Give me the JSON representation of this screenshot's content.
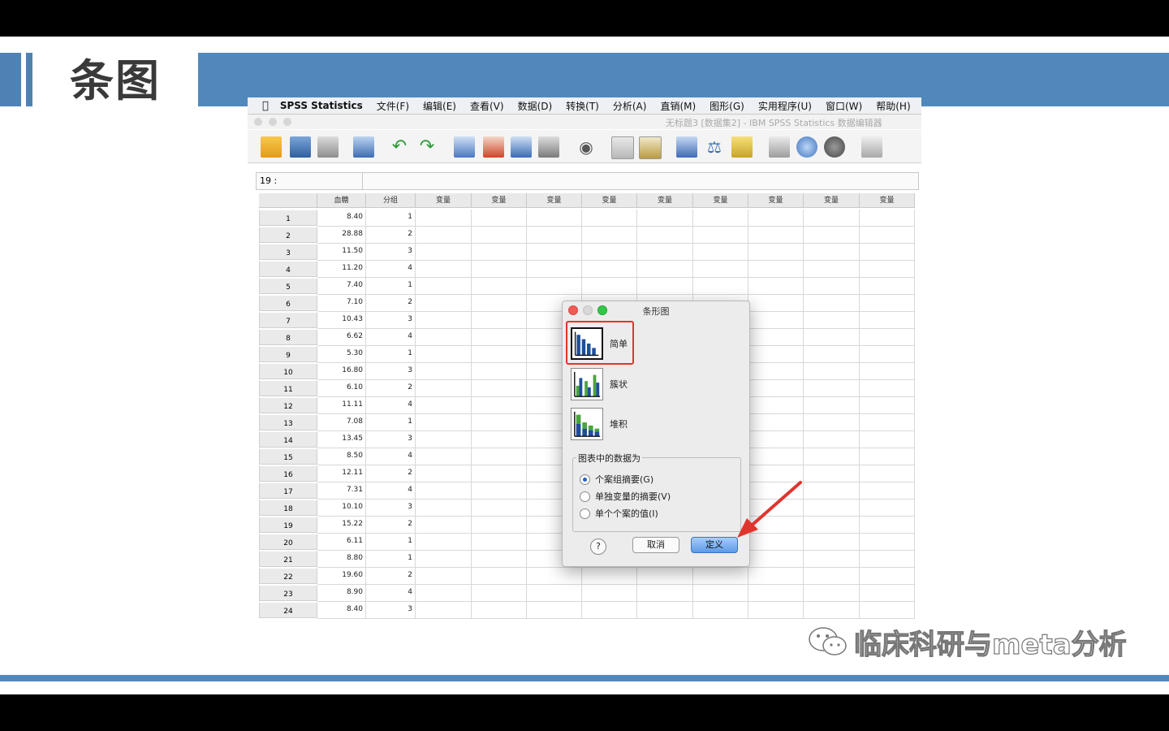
{
  "slide": {
    "title": "条图",
    "watermark": "临床科研与meta分析"
  },
  "spss": {
    "menu": {
      "apple": "",
      "app": "SPSS Statistics",
      "items": [
        "文件(F)",
        "编辑(E)",
        "查看(V)",
        "数据(D)",
        "转换(T)",
        "分析(A)",
        "直销(M)",
        "图形(G)",
        "实用程序(U)",
        "窗口(W)",
        "帮助(H)"
      ]
    },
    "window_title": "无标题3 [数据集2] - IBM SPSS Statistics 数据编辑器",
    "cell_ref": "19 :",
    "columns": [
      "血糖",
      "分组",
      "变量",
      "变量",
      "变量",
      "变量",
      "变量",
      "变量",
      "变量",
      "变量",
      "变量"
    ],
    "rows": [
      {
        "n": "1",
        "v": "8.40",
        "g": "1"
      },
      {
        "n": "2",
        "v": "28.88",
        "g": "2"
      },
      {
        "n": "3",
        "v": "11.50",
        "g": "3"
      },
      {
        "n": "4",
        "v": "11.20",
        "g": "4"
      },
      {
        "n": "5",
        "v": "7.40",
        "g": "1"
      },
      {
        "n": "6",
        "v": "7.10",
        "g": "2"
      },
      {
        "n": "7",
        "v": "10.43",
        "g": "3"
      },
      {
        "n": "8",
        "v": "6.62",
        "g": "4"
      },
      {
        "n": "9",
        "v": "5.30",
        "g": "1"
      },
      {
        "n": "10",
        "v": "16.80",
        "g": "3"
      },
      {
        "n": "11",
        "v": "6.10",
        "g": "2"
      },
      {
        "n": "12",
        "v": "11.11",
        "g": "4"
      },
      {
        "n": "13",
        "v": "7.08",
        "g": "1"
      },
      {
        "n": "14",
        "v": "13.45",
        "g": "3"
      },
      {
        "n": "15",
        "v": "8.50",
        "g": "4"
      },
      {
        "n": "16",
        "v": "12.11",
        "g": "2"
      },
      {
        "n": "17",
        "v": "7.31",
        "g": "4"
      },
      {
        "n": "18",
        "v": "10.10",
        "g": "3"
      },
      {
        "n": "19",
        "v": "15.22",
        "g": "2"
      },
      {
        "n": "20",
        "v": "6.11",
        "g": "1"
      },
      {
        "n": "21",
        "v": "8.80",
        "g": "1"
      },
      {
        "n": "22",
        "v": "19.60",
        "g": "2"
      },
      {
        "n": "23",
        "v": "8.90",
        "g": "4"
      },
      {
        "n": "24",
        "v": "8.40",
        "g": "3"
      }
    ]
  },
  "dialog": {
    "title": "条形图",
    "options": [
      {
        "label": "简单",
        "selected": true,
        "icon": "simple-bar-chart-icon"
      },
      {
        "label": "簇状",
        "selected": false,
        "icon": "clustered-bar-chart-icon"
      },
      {
        "label": "堆积",
        "selected": false,
        "icon": "stacked-bar-chart-icon"
      }
    ],
    "group_title": "图表中的数据为",
    "radios": [
      {
        "label": "个案组摘要(G)",
        "checked": true
      },
      {
        "label": "单独变量的摘要(V)",
        "checked": false
      },
      {
        "label": "单个个案的值(I)",
        "checked": false
      }
    ],
    "help": "?",
    "cancel": "取消",
    "define": "定义"
  },
  "colors": {
    "accent_blue": "#5088bb",
    "highlight_red": "#e0352f",
    "bar_blue": "#1f4e9c",
    "bar_green": "#4aa43a"
  }
}
